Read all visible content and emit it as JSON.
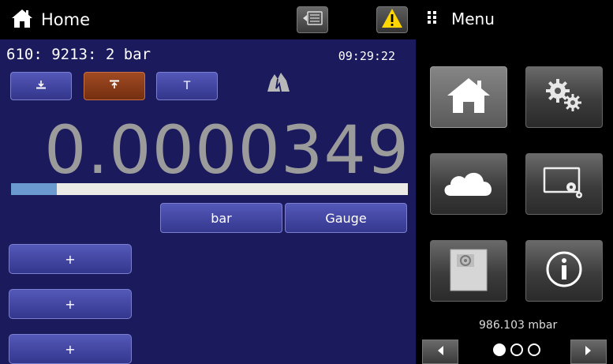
{
  "header": {
    "title": "Home",
    "menu_label": "Menu",
    "warning_icon": "warning-triangle-icon",
    "dock_icon": "screen-dock-icon"
  },
  "channel": {
    "label": "610: 9213:  2 bar",
    "time": "09:29:22"
  },
  "controls": {
    "tare_label": "T",
    "tare_icon": "tare-icon",
    "zero_icon": "zero-icon",
    "auto_icon": "auto-zero-icon",
    "status_icon": "pressure-state-icon"
  },
  "reading": {
    "value": "0.0000349",
    "bar_fraction": 0.115
  },
  "units": {
    "unit_label": "bar",
    "mode_label": "Gauge"
  },
  "plus_buttons": [
    "+",
    "+",
    "+"
  ],
  "sidebar": {
    "tiles": [
      {
        "name": "home-tile",
        "icon": "home-icon",
        "selected": true
      },
      {
        "name": "settings-tile",
        "icon": "gears-icon",
        "selected": false
      },
      {
        "name": "remote-tile",
        "icon": "cloud-icon",
        "selected": false
      },
      {
        "name": "display-tile",
        "icon": "display-settings-icon",
        "selected": false
      },
      {
        "name": "sensor-tile",
        "icon": "sensor-module-icon",
        "selected": false
      },
      {
        "name": "info-tile",
        "icon": "info-icon",
        "selected": false
      }
    ],
    "barometer": "986.103 mbar",
    "page_count": 3,
    "page_index": 0
  },
  "colors": {
    "main_bg": "#1a1a5c",
    "button": "#4449a8",
    "active_button": "#8e3f1a",
    "bar_fill": "#6a9ad0",
    "warning": "#ffd600"
  }
}
